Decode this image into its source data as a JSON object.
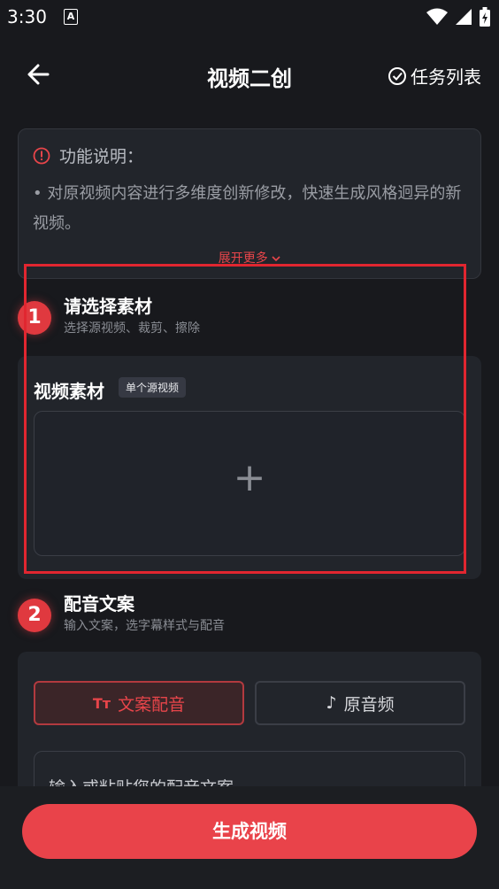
{
  "status_bar": {
    "time": "3:30",
    "notif_icon": "A"
  },
  "header": {
    "title": "视频二创",
    "task_list_label": "任务列表"
  },
  "info": {
    "heading": "功能说明：",
    "body": "• 对原视频内容进行多维度创新修改，快速生成风格迥异的新视频。",
    "expand_label": "展开更多"
  },
  "step1": {
    "number": "1",
    "title": "请选择素材",
    "subtitle": "选择源视频、裁剪、擦除",
    "material_title": "视频素材",
    "material_tag": "单个源视频",
    "plus": "+"
  },
  "step2": {
    "number": "2",
    "title": "配音文案",
    "subtitle": "输入文案，选字幕样式与配音",
    "tab_text_voice": "文案配音",
    "tab_text_voice_icon": "Tт",
    "tab_original_audio": "原音频",
    "tab_original_audio_icon": "♪",
    "input_placeholder": "输入或粘贴您的配音文案"
  },
  "footer": {
    "generate_label": "生成视频"
  },
  "colors": {
    "accent": "#e9434a",
    "background": "#18191d",
    "card": "#22252b"
  }
}
